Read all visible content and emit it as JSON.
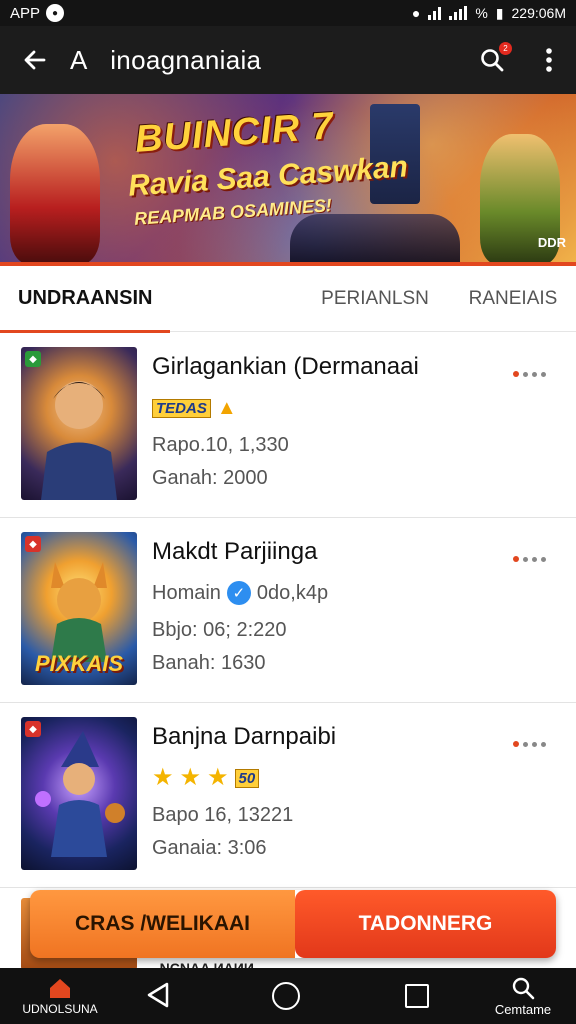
{
  "status_bar": {
    "app_label": "APP",
    "time": "229:06M",
    "battery_text": "%"
  },
  "app_bar": {
    "back_icon": "arrow-left-icon",
    "title_prefix": "A",
    "title": "inoagnaniaia",
    "search_badge": "2"
  },
  "banner": {
    "title": "BUINCIR 7",
    "subtitle": "Ravia Saa Caswkan",
    "tagline": "REAPMAB OSAMINES!",
    "corner_text": "DDR"
  },
  "tabs": [
    {
      "label": "UNDRAANSIN",
      "active": true
    },
    {
      "label": "PERIANLSN",
      "active": false
    },
    {
      "label": "RANEIAIS",
      "active": false
    }
  ],
  "items": [
    {
      "title": "Girlagankian (Dermanaai",
      "tag": "TEDAS",
      "line2": "Rapo.10, 1,330",
      "line3": "Ganah: 2000"
    },
    {
      "title": "Makdt Parjiinga",
      "meta_label": "Homain",
      "meta_value": "0do,k4p",
      "line2": "Bbjo: 06; 2:220",
      "line3": "Banah: 1630",
      "thumb_caption": "PIXKAIS"
    },
    {
      "title": "Banjna Darnpaibi",
      "rating_stars": 3,
      "rating_badge": "50",
      "line2": "Bapo 16, 13221",
      "line3": "Ganaia: 3:06"
    }
  ],
  "actions": {
    "left_label": "CRAS /WELIKAAI",
    "right_label": "TADONNERG"
  },
  "partial_row_text": "‑NCNAA ИАИИ",
  "nav_bar": {
    "home_label": "UDNOLSUNA",
    "search_label": "Cemtame"
  },
  "colors": {
    "accent": "#e2471f",
    "app_bar": "#1c1c1c",
    "verified": "#2d8ef0",
    "star": "#f4b400"
  }
}
